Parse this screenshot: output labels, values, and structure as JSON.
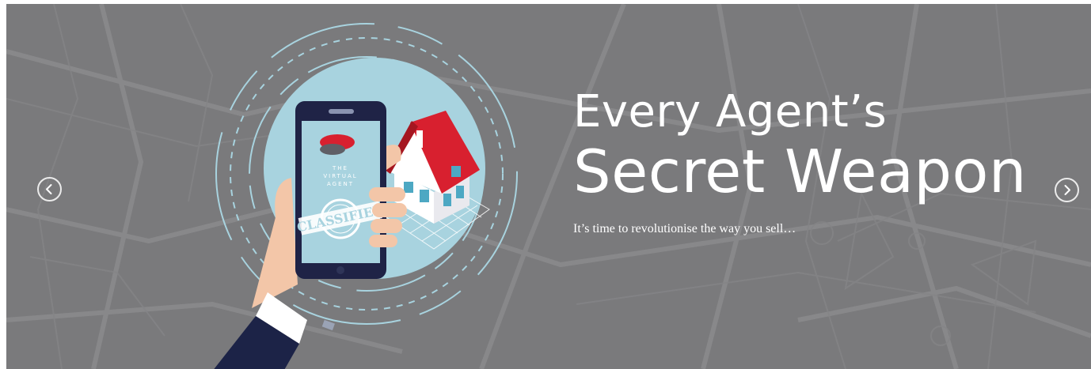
{
  "hero": {
    "headline_line1": "Every Agent’s",
    "headline_line2": "Secret Weapon",
    "subtitle": "It’s time to revolutionise the way you sell…"
  },
  "phone_screen": {
    "logo_text_line1": "THE",
    "logo_text_line2": "VIRTUAL",
    "logo_text_line3": "AGENT",
    "stamp_text": "CLASSIFIED"
  },
  "navigation": {
    "prev_icon": "chevron-left-icon",
    "next_icon": "chevron-right-icon"
  },
  "colors": {
    "background": "#7a7a7c",
    "circle": "#a8d3df",
    "phone": "#1f2346",
    "roof": "#d8202f",
    "sleeve": "#1c2347",
    "skin": "#f3c6a8",
    "text": "#ffffff"
  }
}
